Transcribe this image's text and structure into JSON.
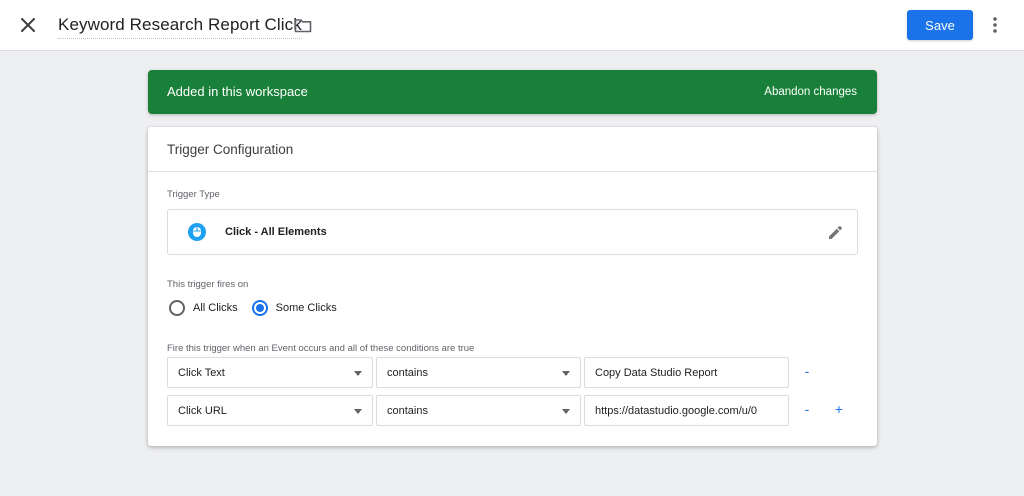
{
  "header": {
    "title": "Keyword Research Report Click",
    "save_label": "Save"
  },
  "banner": {
    "text": "Added in this workspace",
    "action_label": "Abandon changes",
    "color": "#188038"
  },
  "card": {
    "title": "Trigger Configuration",
    "trigger_type_label": "Trigger Type",
    "trigger_type_name": "Click - All Elements",
    "fires_on_label": "This trigger fires on",
    "fires_on_options": [
      "All Clicks",
      "Some Clicks"
    ],
    "fires_on_selected": "Some Clicks",
    "conditions_label": "Fire this trigger when an Event occurs and all of these conditions are true",
    "conditions": [
      {
        "variable": "Click Text",
        "operator": "contains",
        "value": "Copy Data Studio Report"
      },
      {
        "variable": "Click URL",
        "operator": "contains",
        "value": "https://datastudio.google.com/u/0"
      }
    ],
    "remove_label": "-",
    "add_label": "+"
  },
  "colors": {
    "accent": "#1a73e8",
    "trigger_icon": "#1ea1f2"
  }
}
